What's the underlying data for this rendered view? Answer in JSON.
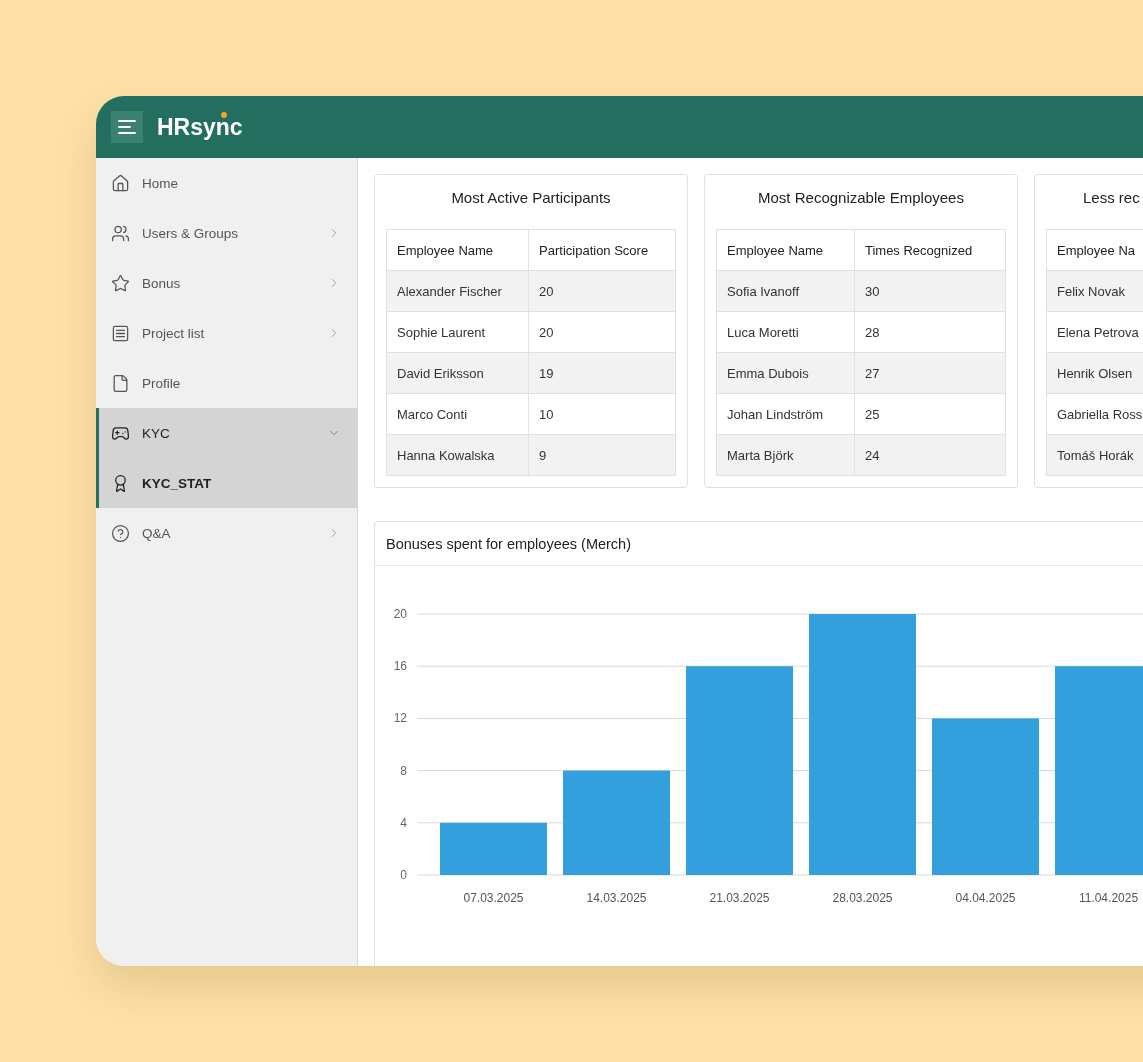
{
  "header": {
    "logo": "HRsync"
  },
  "sidebar": {
    "items": [
      {
        "label": "Home",
        "selected": false
      },
      {
        "label": "Users & Groups",
        "selected": false,
        "expanded": false
      },
      {
        "label": "Bonus",
        "selected": false,
        "expanded": false
      },
      {
        "label": "Project list",
        "selected": false,
        "expanded": false
      },
      {
        "label": "Profile",
        "selected": false
      },
      {
        "label": "KYC",
        "selected": false,
        "expanded": true,
        "children": [
          {
            "label": "KYC_STAT",
            "selected": true
          }
        ]
      },
      {
        "label": "Q&A",
        "selected": false,
        "expanded": false
      }
    ]
  },
  "panels": [
    {
      "title": "Most Active Participants",
      "columns": [
        "Employee Name",
        "Participation Score"
      ],
      "rows": [
        [
          "Alexander Fischer",
          "20"
        ],
        [
          "Sophie Laurent",
          "20"
        ],
        [
          "David Eriksson",
          "19"
        ],
        [
          "Marco Conti",
          "10"
        ],
        [
          "Hanna Kowalska",
          "9"
        ]
      ]
    },
    {
      "title": "Most Recognizable Employees",
      "columns": [
        "Employee Name",
        "Times Recognized"
      ],
      "rows": [
        [
          "Sofia Ivanoff",
          "30"
        ],
        [
          "Luca Moretti",
          "28"
        ],
        [
          "Emma Dubois",
          "27"
        ],
        [
          "Johan Lindström",
          "25"
        ],
        [
          "Marta Björk",
          "24"
        ]
      ]
    },
    {
      "title": "Less rec",
      "columns": [
        "Employee Na"
      ],
      "rows": [
        [
          "Felix Novak"
        ],
        [
          "Elena Petrova"
        ],
        [
          "Henrik Olsen"
        ],
        [
          "Gabriella Ross"
        ],
        [
          "Tomáš Horák"
        ]
      ]
    }
  ],
  "chart": {
    "title": "Bonuses spent for employees (Merch)",
    "chart_data": {
      "type": "bar",
      "categories": [
        "07.03.2025",
        "14.03.2025",
        "21.03.2025",
        "28.03.2025",
        "04.04.2025",
        "11.04.2025"
      ],
      "series": [
        {
          "color": "#339fdd",
          "values": [
            4,
            8,
            16,
            20,
            12,
            16
          ]
        }
      ],
      "grid": true,
      "ylim": [
        0,
        20
      ],
      "yticks": [
        0,
        4,
        8,
        12,
        16,
        20
      ]
    }
  }
}
